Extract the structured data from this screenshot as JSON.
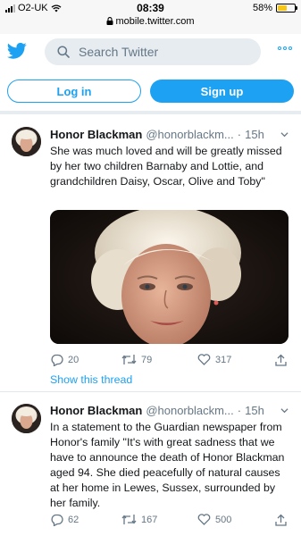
{
  "status_bar": {
    "carrier": "O2-UK",
    "time": "08:39",
    "url": "mobile.twitter.com",
    "battery": "58%",
    "battery_level": 0.58
  },
  "header": {
    "search_placeholder": "Search Twitter"
  },
  "auth": {
    "login_label": "Log in",
    "signup_label": "Sign up"
  },
  "tweets": [
    {
      "name": "Honor Blackman",
      "handle": "@honorblackm...",
      "dot": "·",
      "time": "15h",
      "text": "She was much loved and will be greatly missed by her two children Barnaby and Lottie, and grandchildren Daisy, Oscar, Olive and Toby\"",
      "replies": "20",
      "retweets": "79",
      "likes": "317",
      "show_thread": "Show this thread"
    },
    {
      "name": "Honor Blackman",
      "handle": "@honorblackm...",
      "dot": "·",
      "time": "15h",
      "text": "In a statement to the Guardian newspaper from Honor's family \"It's with great sadness that we have to announce the death of Honor Blackman aged 94. She died peacefully of natural causes at her home in Lewes, Sussex, surrounded by her family.",
      "replies": "62",
      "retweets": "167",
      "likes": "500"
    }
  ],
  "colors": {
    "brand": "#1da1f2",
    "text": "#14171a",
    "muted": "#657786",
    "divider": "#e1e8ed",
    "battery": "#f5c518"
  },
  "icons": [
    "wifi-icon",
    "lock-icon",
    "twitter-bird-icon",
    "search-icon",
    "more-icon",
    "chevron-down-icon",
    "reply-icon",
    "retweet-icon",
    "like-icon",
    "share-icon"
  ]
}
